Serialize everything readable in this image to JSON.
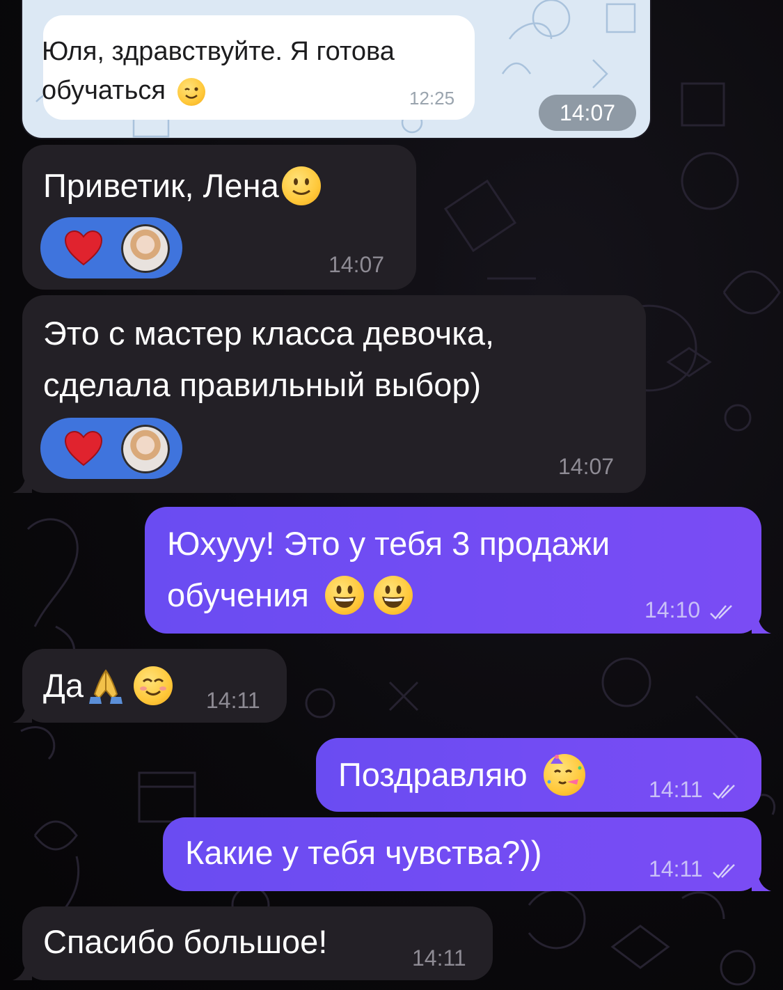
{
  "forwarded_screenshot": {
    "message_text": "Юля, здравствуйте. Я готова обучаться",
    "message_time": "12:25",
    "photo_time": "14:07"
  },
  "messages": [
    {
      "direction": "incoming",
      "text": "Приветик, Лена",
      "time": "14:07",
      "reaction": "heart",
      "emoji": [
        "slightly-smiling-face"
      ]
    },
    {
      "direction": "incoming",
      "lines": [
        "Это с мастер класса девочка,",
        "сделала правильный выбор)"
      ],
      "time": "14:07",
      "reaction": "heart"
    },
    {
      "direction": "outgoing",
      "lines": [
        "Юхууу! Это у тебя 3 продажи",
        "обучения"
      ],
      "time": "14:10",
      "read": true,
      "emoji": [
        "grinning-face",
        "grinning-face"
      ]
    },
    {
      "direction": "incoming",
      "text": "Да",
      "time": "14:11",
      "emoji": [
        "folded-hands",
        "smiling-face-with-smiling-eyes"
      ]
    },
    {
      "direction": "outgoing",
      "text": "Поздравляю",
      "time": "14:11",
      "read": true,
      "emoji": [
        "partying-face"
      ]
    },
    {
      "direction": "outgoing",
      "text": "Какие у тебя чувства?))",
      "time": "14:11",
      "read": true
    },
    {
      "direction": "incoming",
      "text": "Спасибо большое!",
      "time": "14:11"
    }
  ],
  "colors": {
    "incoming_bubble": "#232026",
    "outgoing_bubble": "#6a4cf2",
    "reaction_pill": "#3f74dd",
    "background": "#0b0a0e"
  }
}
